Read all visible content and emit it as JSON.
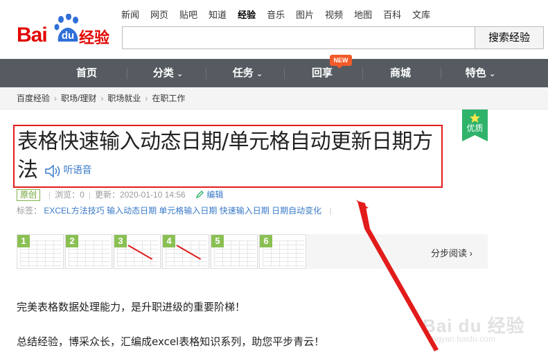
{
  "logo": {
    "bai": "Bai",
    "du": "du",
    "jingyan": "经验"
  },
  "topnav": [
    "新闻",
    "网页",
    "贴吧",
    "知道",
    "经验",
    "音乐",
    "图片",
    "视频",
    "地图",
    "百科",
    "文库"
  ],
  "topnav_active": "经验",
  "search": {
    "value": "",
    "button": "搜索经验"
  },
  "mainnav": {
    "home": "首页",
    "category": "分类",
    "task": "任务",
    "huixiang": "回享",
    "shop": "商城",
    "feature": "特色",
    "new_badge": "NEW",
    "chevron": "⌄"
  },
  "breadcrumb": [
    "百度经验",
    "职场/理财",
    "职场就业",
    "在职工作"
  ],
  "breadcrumb_sep": "›",
  "article": {
    "title": "表格快速输入动态日期/单元格自动更新日期方法",
    "listen": "听语音",
    "badge": "优质",
    "original": "原创",
    "views": "浏览：0",
    "updated": "更新：2020-01-10 14:56",
    "edit": "编辑",
    "tags_label": "标签：",
    "tags": [
      "EXCEL方法技巧",
      "输入动态日期",
      "单元格输入日期",
      "快速输入日期",
      "日期自动变化"
    ],
    "step_numbers": [
      "1",
      "2",
      "3",
      "4",
      "5",
      "6"
    ],
    "step_read": "分步阅读 ›",
    "para1": "完美表格数据处理能力，是升职进级的重要阶梯！",
    "para2": "总结经验，博采众长，汇编成excel表格知识系列，助您平步青云！"
  },
  "watermark": {
    "text": "Bai du 经验",
    "url": "jingyan.baidu.com"
  },
  "colors": {
    "brand_red": "#e10602",
    "nav_bg": "#555b61",
    "link_blue": "#3a79c8",
    "quality_green": "#2fb36b",
    "annotation_red": "#e21b1b"
  }
}
